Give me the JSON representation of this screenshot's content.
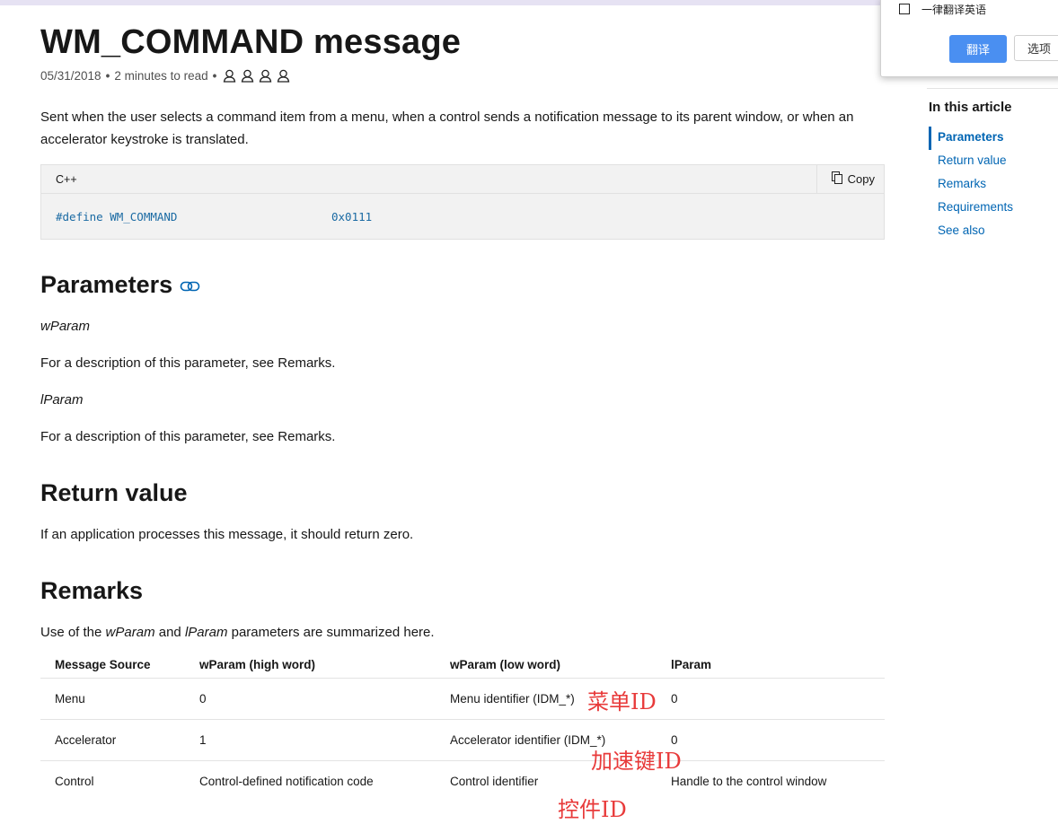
{
  "article": {
    "title": "WM_COMMAND message",
    "date": "05/31/2018",
    "read_time": "2 minutes to read",
    "separator": "•",
    "contributors_count": 4,
    "intro": "Sent when the user selects a command item from a menu, when a control sends a notification message to its parent window, or when an accelerator keystroke is translated."
  },
  "code": {
    "language": "C++",
    "copy_label": "Copy",
    "define_text": "#define WM_COMMAND",
    "value_text": "0x0111"
  },
  "sections": {
    "parameters": {
      "heading": "Parameters",
      "param1_name": "wParam",
      "param1_desc": "For a description of this parameter, see Remarks.",
      "param2_name": "lParam",
      "param2_desc": "For a description of this parameter, see Remarks."
    },
    "return_value": {
      "heading": "Return value",
      "text": "If an application processes this message, it should return zero."
    },
    "remarks": {
      "heading": "Remarks",
      "text_before": "Use of the ",
      "w": "wParam",
      "text_mid": " and ",
      "l": "lParam",
      "text_after": " parameters are summarized here."
    }
  },
  "table": {
    "headers": [
      "Message Source",
      "wParam (high word)",
      "wParam (low word)",
      "lParam"
    ],
    "rows": [
      [
        "Menu",
        "0",
        "Menu identifier (IDM_*)",
        "0"
      ],
      [
        "Accelerator",
        "1",
        "Accelerator identifier (IDM_*)",
        "0"
      ],
      [
        "Control",
        "Control-defined notification code",
        "Control identifier",
        "Handle to the control window"
      ]
    ]
  },
  "annotations": [
    "菜单ID",
    "加速键ID",
    "控件ID"
  ],
  "toc": {
    "title": "In this article",
    "items": [
      "Parameters",
      "Return value",
      "Remarks",
      "Requirements",
      "See also"
    ],
    "active_index": 0
  },
  "translate_popup": {
    "checkbox_label": "一律翻译英语",
    "translate_button": "翻译",
    "options_button": "选项"
  },
  "colors": {
    "link": "#0065b3",
    "code_text": "#1a6aa3",
    "annotation": "#e83a3a",
    "primary_button": "#4a8ff1"
  },
  "icons": {
    "contributor": "person-outline-icon",
    "copy": "copy-icon",
    "anchor": "link-icon",
    "checkbox": "checkbox-icon"
  }
}
